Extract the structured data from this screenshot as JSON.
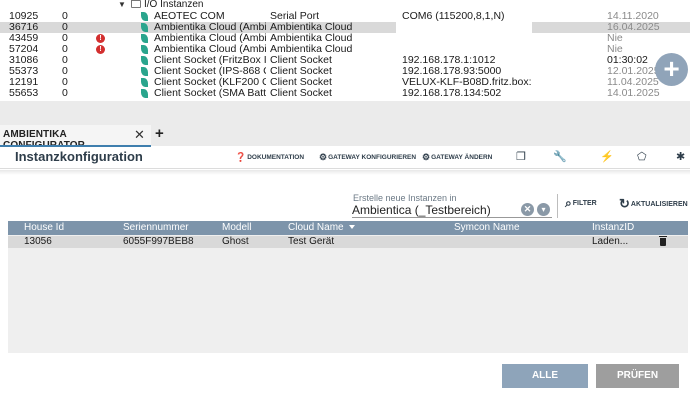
{
  "tree": {
    "folder_label": "I/O Instanzen",
    "rows": [
      {
        "id": "10925",
        "n": "0",
        "warn": false,
        "name": "AEOTEC COM",
        "type": "Serial Port",
        "config": "COM6 (115200,8,1,N)",
        "date": "14.11.2020",
        "date_dark": false
      },
      {
        "id": "36716",
        "n": "0",
        "warn": false,
        "name": "Ambientika Cloud (Ambie...",
        "type": "Ambientika Cloud",
        "config": "",
        "date": "16.04.2025",
        "date_dark": false
      },
      {
        "id": "43459",
        "n": "0",
        "warn": true,
        "name": "Ambientika Cloud (Ambie...",
        "type": "Ambientika Cloud",
        "config": "",
        "date": "Nie",
        "date_dark": false
      },
      {
        "id": "57204",
        "n": "0",
        "warn": true,
        "name": "Ambientika Cloud (Ambie...",
        "type": "Ambientika Cloud",
        "config": "",
        "date": "Nie",
        "date_dark": false
      },
      {
        "id": "31086",
        "n": "0",
        "warn": false,
        "name": "Client Socket (FritzBox IO...",
        "type": "Client Socket",
        "config": "192.168.178.1:1012",
        "date": "01:30:02",
        "date_dark": true
      },
      {
        "id": "55373",
        "n": "0",
        "warn": false,
        "name": "Client Socket (IPS-868 Ga...",
        "type": "Client Socket",
        "config": "192.168.178.93:5000",
        "date": "12.01.2025",
        "date_dark": false
      },
      {
        "id": "12191",
        "n": "0",
        "warn": false,
        "name": "Client Socket (KLF200 Ga...",
        "type": "Client Socket",
        "config": "VELUX-KLF-B08D.fritz.box:51...",
        "date": "11.04.2025",
        "date_dark": false
      },
      {
        "id": "55653",
        "n": "0",
        "warn": false,
        "name": "Client Socket (SMA Batte...",
        "type": "Client Socket",
        "config": "192.168.178.134:502",
        "date": "14.01.2025",
        "date_dark": false
      }
    ]
  },
  "fab_label": "+",
  "tabs": {
    "active_label": "AMBIENTIKA CONFIGURATOR",
    "close_glyph": "✕",
    "add_glyph": "+"
  },
  "header": {
    "title": "Instanzkonfiguration",
    "doc_label": "DOKUMENTATION",
    "gw_config_label": "GATEWAY KONFIGURIEREN",
    "gw_change_label": "GATEWAY ÄNDERN"
  },
  "search": {
    "caption": "Erstelle neue Instanzen in",
    "value": "Ambientica (_Testbereich)",
    "filter_label": "FILTER",
    "refresh_label": "AKTUALISIEREN"
  },
  "table": {
    "columns": [
      "House Id",
      "Seriennummer",
      "Modell",
      "Cloud Name",
      "Symcon Name",
      "InstanzID"
    ],
    "rows": [
      {
        "house_id": "13056",
        "serial": "6055F997BEB8",
        "model": "Ghost",
        "cloud_name": "Test Gerät",
        "symcon_name": "",
        "instance_id": "Laden..."
      }
    ]
  },
  "buttons": {
    "create_all": "ALLE ERSTELLEN",
    "check": "PRÜFEN"
  }
}
